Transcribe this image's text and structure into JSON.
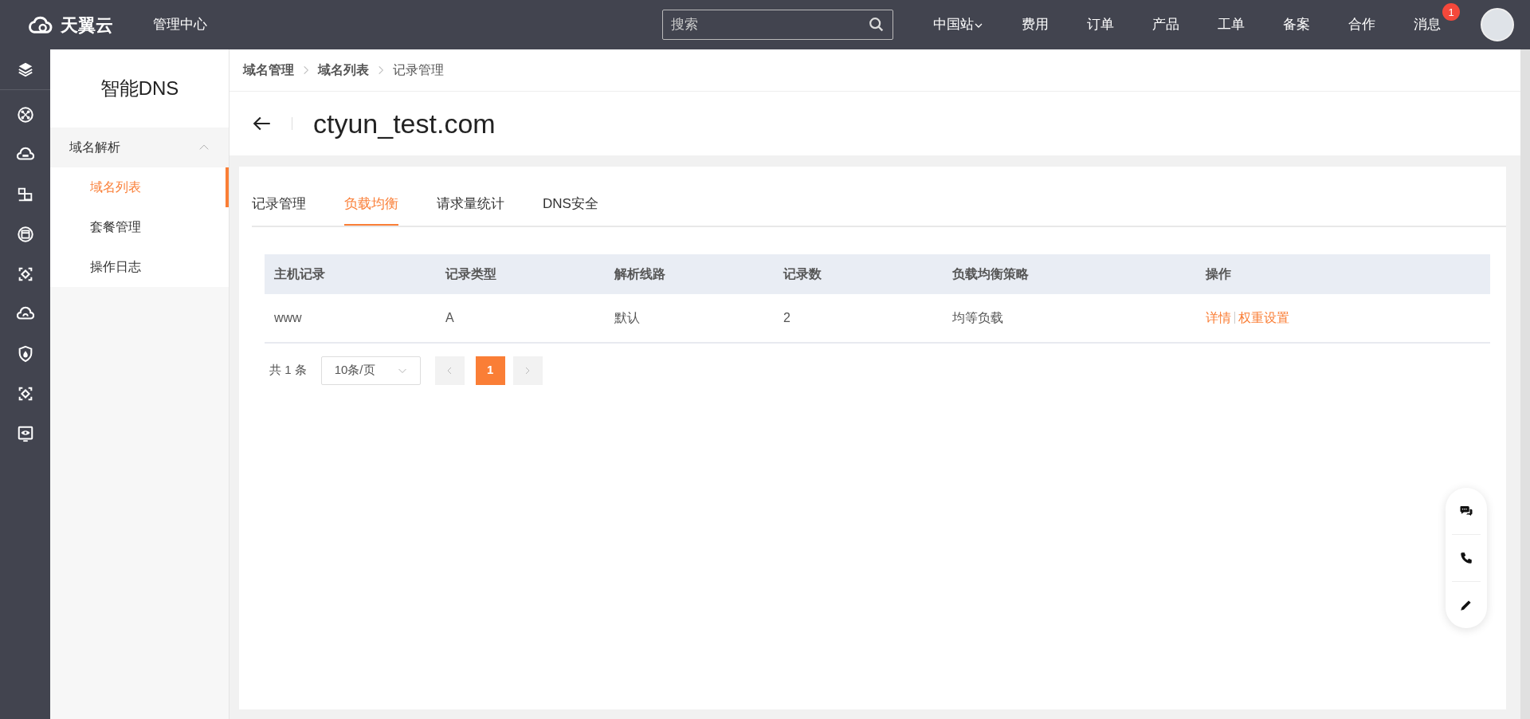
{
  "top_bar": {
    "logo": "天翼云",
    "title": "管理中心",
    "search": {
      "placeholder": "搜索"
    },
    "nav": [
      {
        "label": "中国站",
        "kind": "dropdown"
      },
      {
        "label": "费用",
        "kind": "link"
      },
      {
        "label": "订单",
        "kind": "link"
      },
      {
        "label": "产品",
        "kind": "link"
      },
      {
        "label": "工单",
        "kind": "link"
      },
      {
        "label": "备案",
        "kind": "link"
      },
      {
        "label": "合作",
        "kind": "link"
      },
      {
        "label": "消息",
        "kind": "link",
        "badge": "1"
      }
    ]
  },
  "sidebar": {
    "title": "智能DNS",
    "groups": [
      {
        "label": "域名解析",
        "expanded": true,
        "children": [
          {
            "label": "域名列表",
            "selected": true
          },
          {
            "label": "套餐管理",
            "selected": false
          },
          {
            "label": "操作日志",
            "selected": false
          }
        ]
      }
    ]
  },
  "breadcrumb": [
    {
      "label": "域名管理",
      "kind": "link"
    },
    {
      "label": "域名列表",
      "kind": "link"
    },
    {
      "label": "记录管理",
      "kind": "current"
    }
  ],
  "page_title": "ctyun_test.com",
  "tabs": [
    {
      "label": "记录管理",
      "selected": false
    },
    {
      "label": "负载均衡",
      "selected": true
    },
    {
      "label": "请求量统计",
      "selected": false
    },
    {
      "label": "DNS安全",
      "selected": false
    }
  ],
  "table": {
    "columns": [
      "主机记录",
      "记录类型",
      "解析线路",
      "记录数",
      "负载均衡策略",
      "操作"
    ],
    "rows": [
      {
        "cells": [
          "www",
          "A",
          "默认",
          "2",
          "均等负载"
        ],
        "actions": [
          "详情",
          "权重设置"
        ]
      }
    ]
  },
  "pagination": {
    "total": "共 1 条",
    "page_size": "10条/页",
    "pages": [
      {
        "label": "1",
        "selected": true
      }
    ]
  }
}
